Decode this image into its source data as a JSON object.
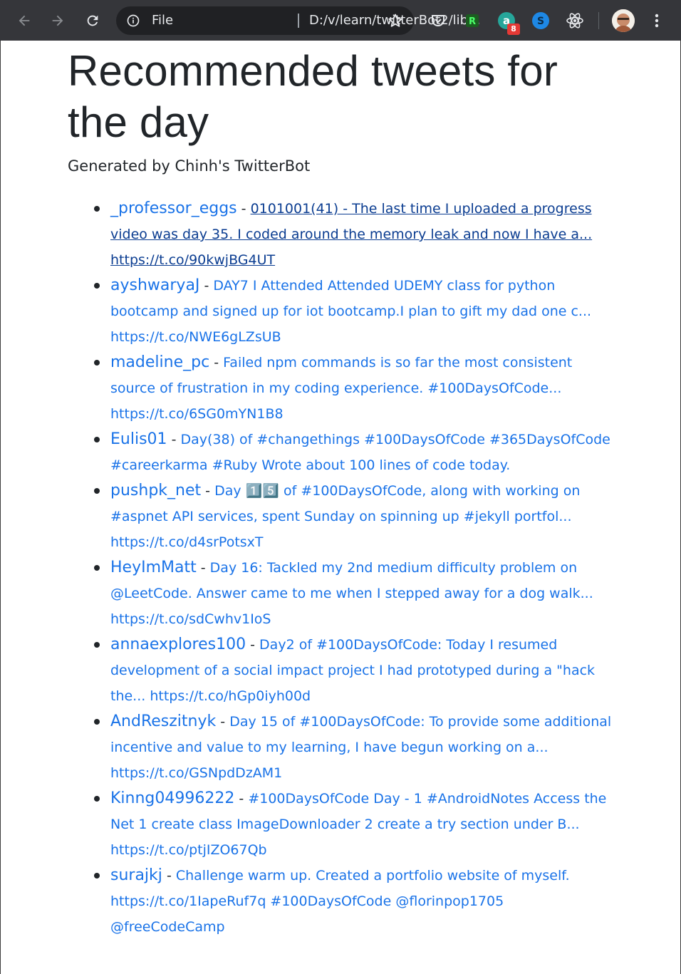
{
  "browser": {
    "omnibox_scheme": "File",
    "omnibox_url": "D:/v/learn/twitterBot2/lib...",
    "extension_badge_count": "8"
  },
  "page": {
    "title": "Recommended tweets for the day",
    "subtitle": "Generated by Chinh's TwitterBot"
  },
  "tweets": [
    {
      "handle": "_professor_eggs",
      "text": "0101001(41) - The last time I uploaded a progress video was day 35. I coded around the memory leak and now I have a... https://t.co/90kwjBG4UT"
    },
    {
      "handle": "ayshwaryaJ",
      "text": "DAY7 I Attended Attended UDEMY class for python bootcamp and signed up for iot bootcamp.I plan to gift my dad one c... https://t.co/NWE6gLZsUB"
    },
    {
      "handle": "madeline_pc",
      "text": "Failed npm commands is so far the most consistent source of frustration in my coding experience. #100DaysOfCode... https://t.co/6SG0mYN1B8"
    },
    {
      "handle": "Eulis01",
      "text": "Day(38) of #changethings #100DaysOfCode #365DaysOfCode #careerkarma #Ruby Wrote about 100 lines of code today."
    },
    {
      "handle": "pushpk_net",
      "text": "Day 1️⃣5️⃣ of #100DaysOfCode, along with working on #aspnet API services, spent Sunday on spinning up #jekyll portfol... https://t.co/d4srPotsxT"
    },
    {
      "handle": "HeyImMatt",
      "text": "Day 16: Tackled my 2nd medium difficulty problem on @LeetCode. Answer came to me when I stepped away for a dog walk... https://t.co/sdCwhv1IoS"
    },
    {
      "handle": "annaexplores100",
      "text": "Day2 of #100DaysOfCode: Today I resumed development of a social impact project I had prototyped during a \"hack the... https://t.co/hGp0iyh00d"
    },
    {
      "handle": "AndReszitnyk",
      "text": "Day 15 of #100DaysOfCode: To provide some additional incentive and value to my learning, I have begun working on a... https://t.co/GSNpdDzAM1"
    },
    {
      "handle": "Kinng04996222",
      "text": "#100DaysOfCode Day - 1 #AndroidNotes Access the Net 1 create class ImageDownloader 2 create a try section under B... https://t.co/ptjIZO67Qb"
    },
    {
      "handle": "surajkj",
      "text": "Challenge warm up. Created a portfolio website of myself. https://t.co/1IapeRuf7q #100DaysOfCode @florinpop1705 @freeCodeCamp"
    }
  ],
  "separator": " - ",
  "colors": {
    "toolbar": "#35363a",
    "omnibox": "#202124",
    "link": "#1a73e8",
    "visited_link": "#0b3d91",
    "text": "#212529"
  }
}
